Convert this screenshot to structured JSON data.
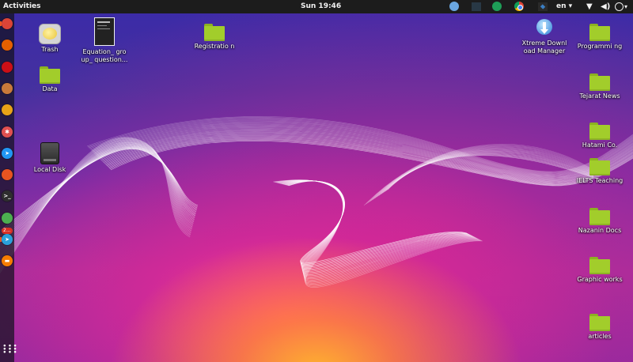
{
  "topbar": {
    "activities": "Activities",
    "clock": "Sun 19:46",
    "language": "en ▾",
    "tray": {
      "icons": [
        "app-indicator-icon",
        "dropbox-icon",
        "hangouts-icon",
        "chrome-tray-icon",
        "keyboard-language-icon",
        "wifi-icon",
        "volume-icon",
        "power-icon"
      ]
    }
  },
  "dock": {
    "apps": [
      {
        "name": "chrome",
        "icon": "chrome-icon",
        "color": "#db4437",
        "active": true
      },
      {
        "name": "firefox",
        "icon": "firefox-icon",
        "color": "#e66000",
        "active": false
      },
      {
        "name": "opera",
        "icon": "opera-icon",
        "color": "#cc0f16",
        "active": false
      },
      {
        "name": "archive-manager",
        "icon": "archive-icon",
        "color": "#c87a3a",
        "active": false
      },
      {
        "name": "rhythmbox",
        "icon": "rhythmbox-icon",
        "color": "#e8a317",
        "active": false
      },
      {
        "name": "settings",
        "icon": "gear-icon",
        "color": "#e05050",
        "active": false
      },
      {
        "name": "safari-like-browser",
        "icon": "compass-icon",
        "color": "#2196f3",
        "active": false
      },
      {
        "name": "software-center",
        "icon": "shopping-bag-icon",
        "color": "#e95420",
        "active": false
      },
      {
        "name": "terminal",
        "icon": "terminal-icon",
        "color": "#2e2e2e",
        "active": false
      },
      {
        "name": "android-studio",
        "icon": "android-icon",
        "color": "#4caf50",
        "active": false
      },
      {
        "name": "telegram",
        "icon": "telegram-icon",
        "color": "#2aa1da",
        "active": true,
        "badge": "2..."
      },
      {
        "name": "notes",
        "icon": "notes-icon",
        "color": "#f57c00",
        "active": false
      }
    ],
    "show_apps_icon": "grid-icon"
  },
  "desktop": {
    "items": [
      {
        "id": "trash",
        "label": "Trash",
        "icon": "trash-icon"
      },
      {
        "id": "equation",
        "label": "Equation_ group_ question...",
        "icon": "document-thumbnail-icon"
      },
      {
        "id": "registration",
        "label": "Registratio n",
        "icon": "folder-icon"
      },
      {
        "id": "xtreme",
        "label": "Xtreme Download Manager",
        "icon": "xdm-icon"
      },
      {
        "id": "programming",
        "label": "Programmi ng",
        "icon": "folder-icon"
      },
      {
        "id": "data",
        "label": "Data",
        "icon": "folder-icon"
      },
      {
        "id": "tejarat",
        "label": "Tejarat News",
        "icon": "folder-icon"
      },
      {
        "id": "hatami",
        "label": "Hatami Co.",
        "icon": "folder-icon"
      },
      {
        "id": "local-disk",
        "label": "Local Disk",
        "icon": "disk-icon"
      },
      {
        "id": "ielts",
        "label": "IELTS Teaching",
        "icon": "folder-icon"
      },
      {
        "id": "nazanin",
        "label": "Nazanin Docs",
        "icon": "folder-icon"
      },
      {
        "id": "graphic",
        "label": "Graphic works",
        "icon": "folder-icon"
      },
      {
        "id": "articles",
        "label": "articles",
        "icon": "folder-icon"
      }
    ]
  }
}
